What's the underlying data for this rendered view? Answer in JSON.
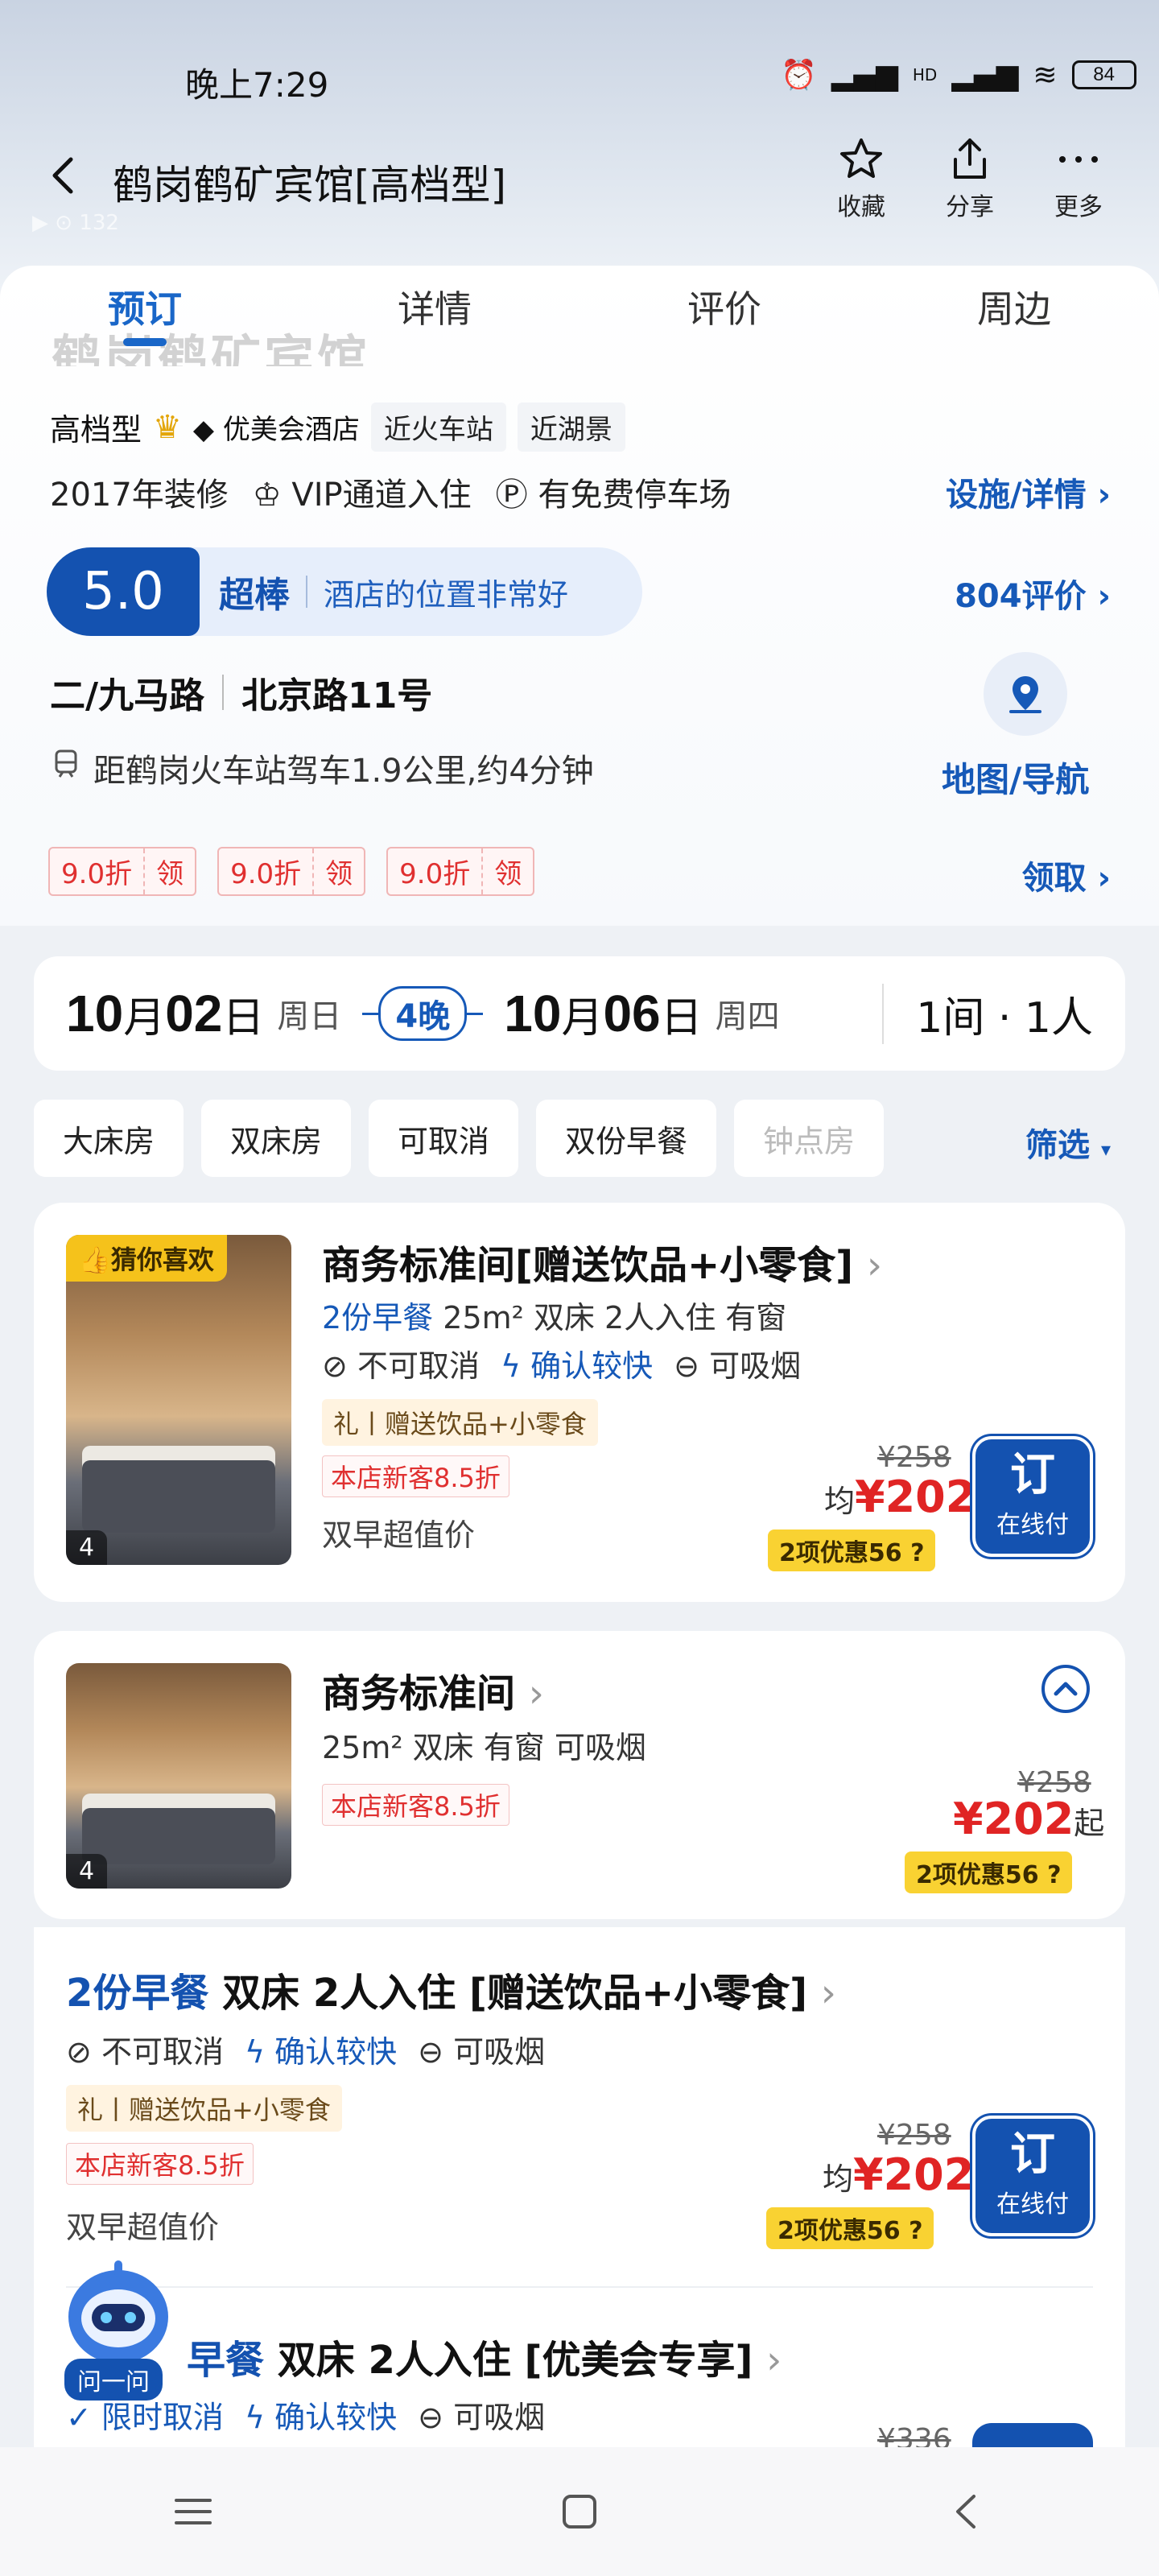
{
  "status": {
    "time": "晚上7:29",
    "battery": "84",
    "hd": "HD"
  },
  "header": {
    "title": "鹤岗鹤矿宾馆[高档型]",
    "view_count": "132",
    "actions": [
      {
        "label": "收藏",
        "icon": "star-icon"
      },
      {
        "label": "分享",
        "icon": "share-icon"
      },
      {
        "label": "更多",
        "icon": "more-icon"
      }
    ]
  },
  "tabs": [
    "预订",
    "详情",
    "评价",
    "周边"
  ],
  "hotel": {
    "ghost_name": "鹤岗鹤矿宾馆",
    "grade": "高档型",
    "tags": [
      "优美会酒店",
      "近火车站",
      "近湖景"
    ],
    "facilities": [
      "2017年装修",
      "VIP通道入住",
      "有免费停车场"
    ],
    "facilities_link": "设施/详情",
    "score": "5.0",
    "score_word": "超棒",
    "score_desc": "酒店的位置非常好",
    "review_link": "804评价",
    "address_area": "二/九马路",
    "address_street": "北京路11号",
    "distance": "距鹤岗火车站驾车1.9公里,约4分钟",
    "map_label": "地图/导航",
    "coupons": [
      {
        "discount": "9.0折",
        "action": "领"
      },
      {
        "discount": "9.0折",
        "action": "领"
      },
      {
        "discount": "9.0折",
        "action": "领"
      }
    ],
    "coupon_link": "领取"
  },
  "dates": {
    "checkin_num": "10",
    "checkin_month": "月",
    "checkin_day": "02",
    "checkin_unit": "日",
    "checkin_week": "周日",
    "nights": "4晚",
    "checkout_num": "10",
    "checkout_month": "月",
    "checkout_day": "06",
    "checkout_unit": "日",
    "checkout_week": "周四",
    "rooms_people": "1间 · 1人"
  },
  "filters": [
    "大床房",
    "双床房",
    "可取消",
    "双份早餐",
    "钟点房"
  ],
  "filter_link": "筛选",
  "rooms": [
    {
      "badge": "猜你喜欢",
      "name": "商务标准间[赠送饮品+小零食]",
      "sub_blue": "2份早餐",
      "sub": "25m² 双床 2人入住 有窗",
      "features": [
        "不可取消",
        "确认较快",
        "可吸烟"
      ],
      "gift": "礼丨赠送饮品+小零食",
      "new_tag": "本店新客8.5折",
      "double_bf": "双早超值价",
      "old_price": "¥258",
      "avg_prefix": "均",
      "price": "¥202",
      "discount": "2项优惠56",
      "book": "订",
      "book_sub": "在线付",
      "photo_count": "4"
    },
    {
      "name": "商务标准间",
      "sub": "25m² 双床 有窗 可吸烟",
      "new_tag": "本店新客8.5折",
      "old_price": "¥258",
      "price": "¥202",
      "price_suffix": "起",
      "discount": "2项优惠56",
      "photo_count": "4"
    }
  ],
  "plans": [
    {
      "title_blue": "2份早餐",
      "title": "双床 2人入住 [赠送饮品+小零食]",
      "features": [
        "不可取消",
        "确认较快",
        "可吸烟"
      ],
      "gift": "礼丨赠送饮品+小零食",
      "new_tag": "本店新客8.5折",
      "double_bf": "双早超值价",
      "old_price": "¥258",
      "avg_prefix": "均",
      "price": "¥202",
      "discount": "2项优惠56",
      "book": "订",
      "book_sub": "在线付"
    },
    {
      "title_blue": "早餐",
      "title": "双床 2人入住 [优美会专享]",
      "features": [
        "限时取消",
        "确认较快",
        "可吸烟"
      ],
      "old_price": "¥336"
    }
  ],
  "assistant_label": "问一问",
  "colors": {
    "brand_blue": "#1452b0",
    "price_red": "#e02424",
    "badge_yellow": "#f9d232"
  }
}
